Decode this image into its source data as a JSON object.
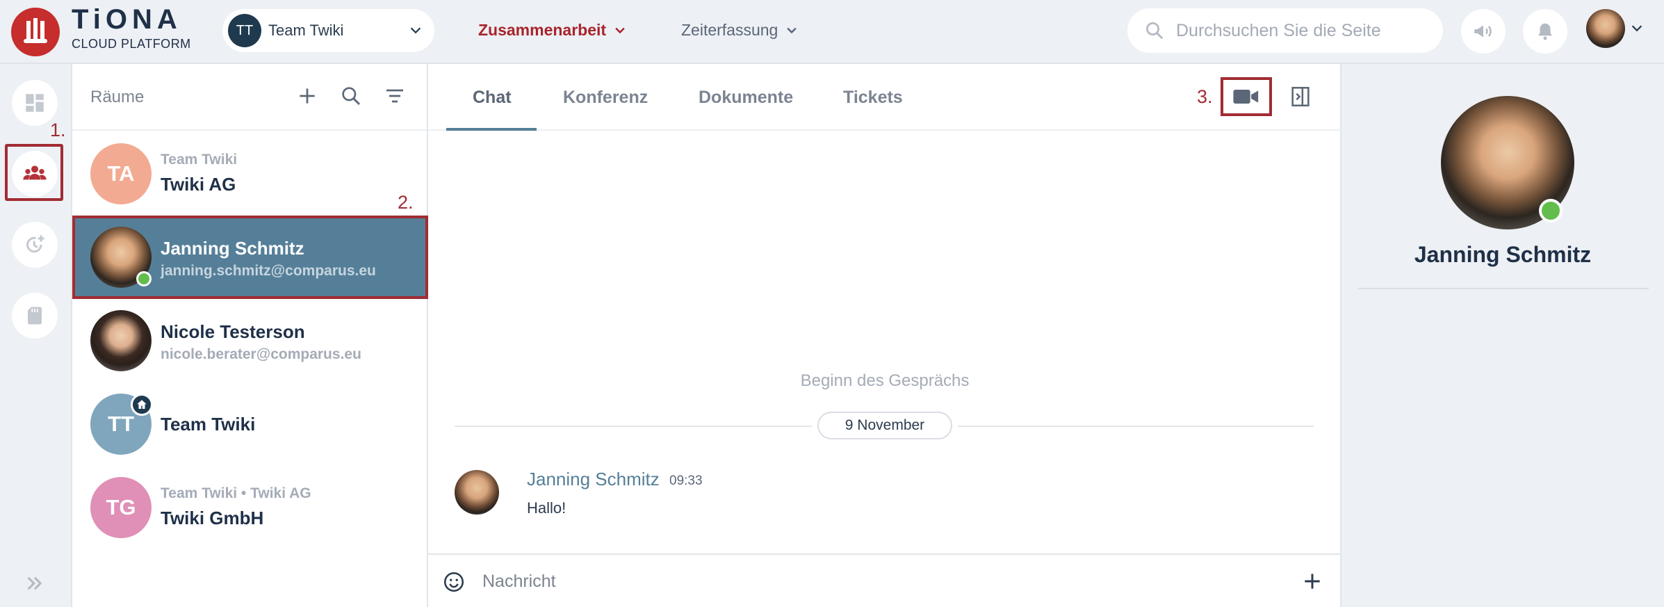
{
  "brand": {
    "title": "TiONA",
    "subtitle": "CLOUD PLATFORM",
    "color": "#c62d2d"
  },
  "team_selector": {
    "initials": "TT",
    "name": "Team Twiki"
  },
  "topnav": [
    {
      "label": "Zusammenarbeit",
      "active": true
    },
    {
      "label": "Zeiterfassung",
      "active": false
    }
  ],
  "search": {
    "placeholder": "Durchsuchen Sie die Seite"
  },
  "annotations": {
    "step1": "1.",
    "step2": "2.",
    "step3": "3.",
    "color": "#a12c33"
  },
  "rooms": {
    "title": "Räume",
    "items": [
      {
        "initials": "TA",
        "subtitle": "Team Twiki",
        "title": "Twiki AG",
        "color": "#f3aa92"
      },
      {
        "subtitle": "",
        "title": "Janning Schmitz",
        "detail": "janning.schmitz@comparus.eu",
        "selected": true,
        "online": true
      },
      {
        "subtitle": "",
        "title": "Nicole Testerson",
        "detail": "nicole.berater@comparus.eu"
      },
      {
        "initials": "TT",
        "title": "Team Twiki",
        "color": "#7fa6bd",
        "home_badge": true
      },
      {
        "initials": "TG",
        "subtitle": "Team Twiki • Twiki AG",
        "title": "Twiki GmbH",
        "color": "#e08fb6"
      }
    ]
  },
  "chat": {
    "tabs": [
      "Chat",
      "Konferenz",
      "Dokumente",
      "Tickets"
    ],
    "active_tab": "Chat",
    "conversation_start": "Beginn des Gesprächs",
    "date": "9 November",
    "message": {
      "author": "Janning Schmitz",
      "time": "09:33",
      "text": "Hallo!"
    },
    "composer_placeholder": "Nachricht"
  },
  "profile": {
    "name": "Janning Schmitz",
    "online": true
  }
}
